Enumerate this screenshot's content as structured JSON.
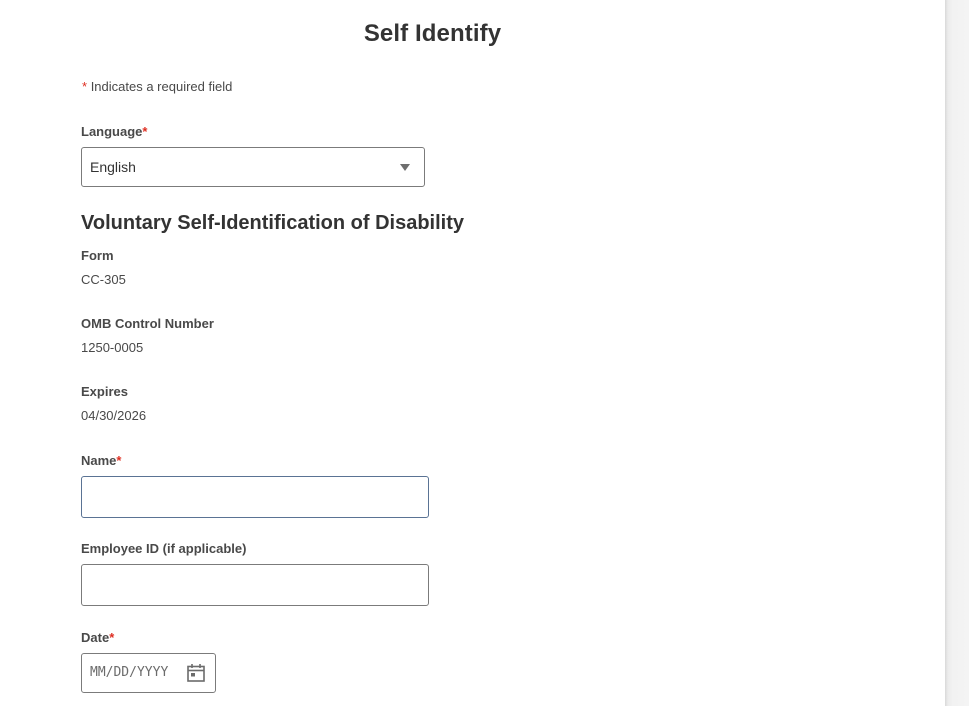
{
  "page": {
    "title": "Self Identify",
    "required_note_star": "*",
    "required_note": "Indicates a required field"
  },
  "language": {
    "label": "Language",
    "required": "*",
    "selected": "English"
  },
  "section": {
    "heading": "Voluntary Self-Identification of Disability"
  },
  "info": {
    "form_label": "Form",
    "form_value": "CC-305",
    "omb_label": "OMB Control Number",
    "omb_value": "1250-0005",
    "expires_label": "Expires",
    "expires_value": "04/30/2026"
  },
  "fields": {
    "name_label": "Name",
    "name_required": "*",
    "name_value": "",
    "employee_id_label": "Employee ID (if applicable)",
    "employee_id_value": "",
    "date_label": "Date",
    "date_required": "*",
    "date_placeholder": "MM/DD/YYYY"
  },
  "icons": {
    "dropdown": "caret-down-icon",
    "calendar": "calendar-icon"
  },
  "colors": {
    "required_star": "#de2e21",
    "focused_border": "#5a7394",
    "input_border": "#7b7b7b"
  }
}
